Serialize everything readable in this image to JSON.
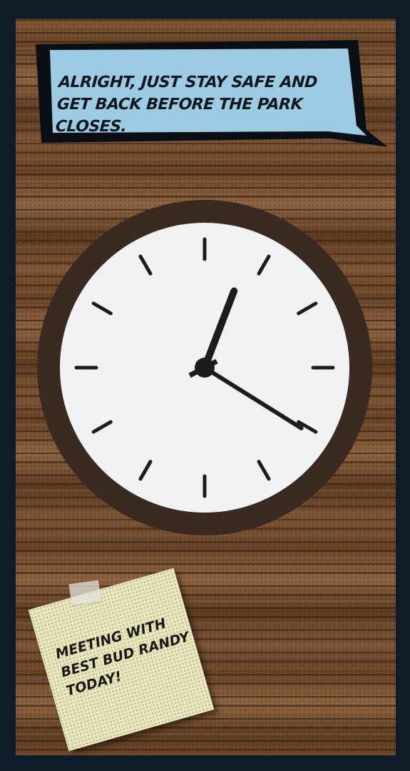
{
  "speech_bubble": {
    "text": "ALRIGHT, JUST STAY SAFE AND GET BACK BEFORE THE PARK CLOSES."
  },
  "clock": {
    "time": "1:22",
    "hour_hand_angle_deg": 21,
    "minute_hand_angle_deg": 122
  },
  "sticky_note": {
    "text": "MEETING WITH\nBEST BUD RANDY\nTODAY!"
  },
  "colors": {
    "frame": "#0f1b29",
    "wood": "#7d5636",
    "bubble_fill": "#9ecbe4",
    "clock_rim": "#3a2a22",
    "clock_face": "#f1f2f4",
    "note_paper": "#e9e6bd"
  }
}
